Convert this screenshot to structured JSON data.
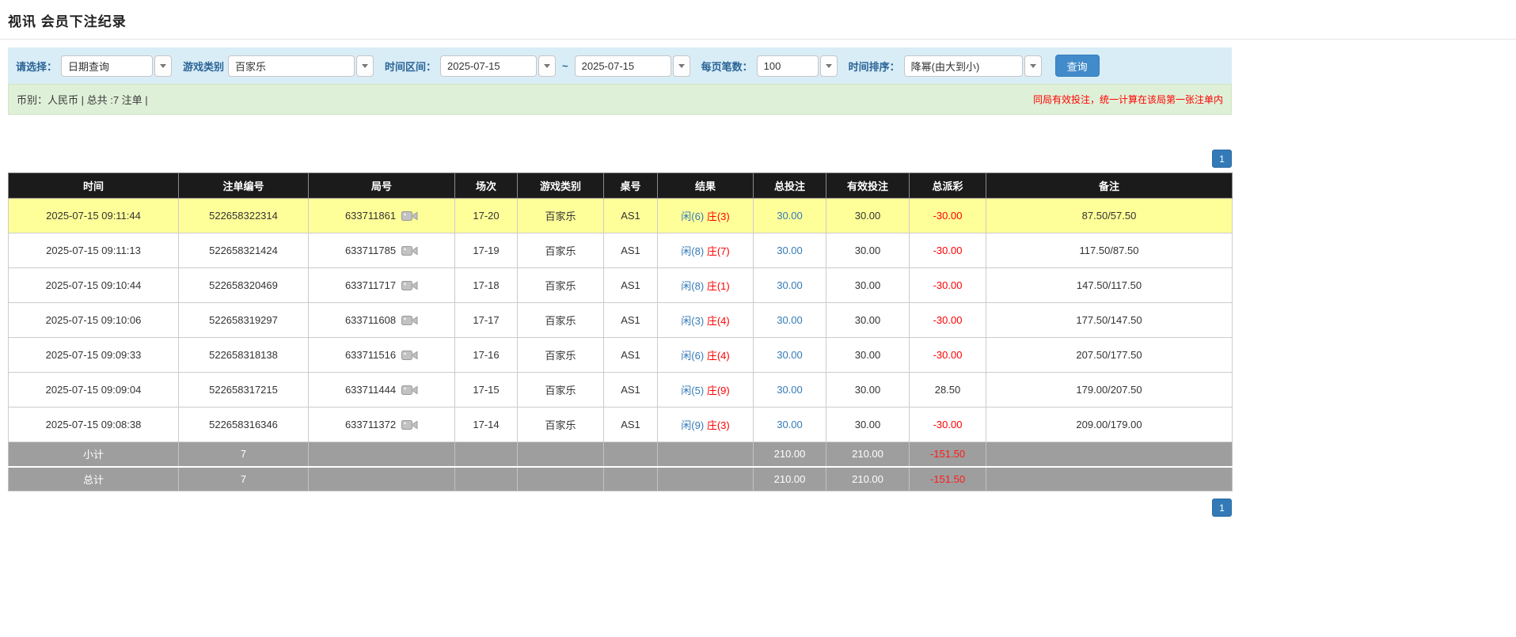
{
  "page": {
    "title": "视讯 会员下注纪录"
  },
  "filters": {
    "select_label": "请选择：",
    "select_value": "日期查询",
    "game_label": "游戏类别",
    "game_value": "百家乐",
    "range_label": "时间区间：",
    "range_from": "2025-07-15",
    "range_separator": "~",
    "range_to": "2025-07-15",
    "page_size_label": "每页笔数：",
    "page_size_value": "100",
    "sort_label": "时间排序：",
    "sort_value": "降幂(由大到小)",
    "search_label": "查询"
  },
  "summary": {
    "left_text": "币别：人民币 | 总共 :7 注单 |",
    "right_notice": "同局有效投注，统一计算在该局第一张注单内"
  },
  "pagination": {
    "page": "1"
  },
  "table": {
    "headers": [
      "时间",
      "注单编号",
      "局号",
      "场次",
      "游戏类别",
      "桌号",
      "结果",
      "总投注",
      "有效投注",
      "总派彩",
      "备注"
    ],
    "rows": [
      {
        "highlighted": true,
        "time": "2025-07-15 09:11:44",
        "bet_id": "522658322314",
        "round": "633711861",
        "session": "17-20",
        "game": "百家乐",
        "table_no": "AS1",
        "result_player": "闲(6)",
        "result_banker": "庄(3)",
        "total_bet": "30.00",
        "valid_bet": "30.00",
        "payout": "-30.00",
        "remark": "87.50/57.50"
      },
      {
        "highlighted": false,
        "time": "2025-07-15 09:11:13",
        "bet_id": "522658321424",
        "round": "633711785",
        "session": "17-19",
        "game": "百家乐",
        "table_no": "AS1",
        "result_player": "闲(8)",
        "result_banker": "庄(7)",
        "total_bet": "30.00",
        "valid_bet": "30.00",
        "payout": "-30.00",
        "remark": "117.50/87.50"
      },
      {
        "highlighted": false,
        "time": "2025-07-15 09:10:44",
        "bet_id": "522658320469",
        "round": "633711717",
        "session": "17-18",
        "game": "百家乐",
        "table_no": "AS1",
        "result_player": "闲(8)",
        "result_banker": "庄(1)",
        "total_bet": "30.00",
        "valid_bet": "30.00",
        "payout": "-30.00",
        "remark": "147.50/117.50"
      },
      {
        "highlighted": false,
        "time": "2025-07-15 09:10:06",
        "bet_id": "522658319297",
        "round": "633711608",
        "session": "17-17",
        "game": "百家乐",
        "table_no": "AS1",
        "result_player": "闲(3)",
        "result_banker": "庄(4)",
        "total_bet": "30.00",
        "valid_bet": "30.00",
        "payout": "-30.00",
        "remark": "177.50/147.50"
      },
      {
        "highlighted": false,
        "time": "2025-07-15 09:09:33",
        "bet_id": "522658318138",
        "round": "633711516",
        "session": "17-16",
        "game": "百家乐",
        "table_no": "AS1",
        "result_player": "闲(6)",
        "result_banker": "庄(4)",
        "total_bet": "30.00",
        "valid_bet": "30.00",
        "payout": "-30.00",
        "remark": "207.50/177.50"
      },
      {
        "highlighted": false,
        "time": "2025-07-15 09:09:04",
        "bet_id": "522658317215",
        "round": "633711444",
        "session": "17-15",
        "game": "百家乐",
        "table_no": "AS1",
        "result_player": "闲(5)",
        "result_banker": "庄(9)",
        "total_bet": "30.00",
        "valid_bet": "30.00",
        "payout": "28.50",
        "remark": "179.00/207.50"
      },
      {
        "highlighted": false,
        "time": "2025-07-15 09:08:38",
        "bet_id": "522658316346",
        "round": "633711372",
        "session": "17-14",
        "game": "百家乐",
        "table_no": "AS1",
        "result_player": "闲(9)",
        "result_banker": "庄(3)",
        "total_bet": "30.00",
        "valid_bet": "30.00",
        "payout": "-30.00",
        "remark": "209.00/179.00"
      }
    ],
    "footer": [
      {
        "label": "小计",
        "count": "7",
        "total_bet": "210.00",
        "valid_bet": "210.00",
        "payout": "-151.50"
      },
      {
        "label": "总计",
        "count": "7",
        "total_bet": "210.00",
        "valid_bet": "210.00",
        "payout": "-151.50"
      }
    ]
  }
}
